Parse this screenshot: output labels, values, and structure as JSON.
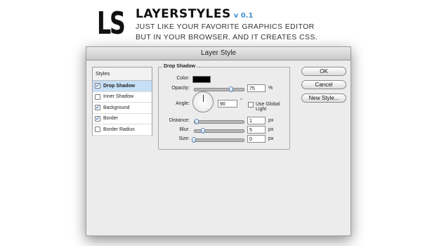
{
  "header": {
    "logo": "LS",
    "title": "LAYERSTYLES",
    "version": "v 0.1",
    "tagline_line1": "JUST LIKE YOUR FAVORITE GRAPHICS EDITOR",
    "tagline_line2": "BUT IN YOUR BROWSER. AND IT CREATES CSS."
  },
  "dialog": {
    "title": "Layer Style",
    "styles_header": "Styles",
    "styles": [
      {
        "label": "Drop Shadow",
        "checked": true,
        "selected": true
      },
      {
        "label": "Inner Shadow",
        "checked": false,
        "selected": false
      },
      {
        "label": "Background",
        "checked": true,
        "selected": false
      },
      {
        "label": "Border",
        "checked": true,
        "selected": false
      },
      {
        "label": "Border Radius",
        "checked": false,
        "selected": false
      }
    ],
    "panel": {
      "title": "Drop Shadow",
      "color_label": "Color:",
      "color_value": "#000000",
      "opacity_label": "Opacity:",
      "opacity_value": "75",
      "opacity_unit": "%",
      "opacity_slider": 0.75,
      "angle_label": "Angle:",
      "angle_value": "90",
      "angle_unit": "°",
      "global_light_label": "Use Global Light",
      "distance_label": "Distance:",
      "distance_value": "1",
      "distance_unit": "px",
      "distance_slider": 0.05,
      "blur_label": "Blur:",
      "blur_value": "5",
      "blur_unit": "px",
      "blur_slider": 0.18,
      "size_label": "Size:",
      "size_value": "0",
      "size_unit": "px",
      "size_slider": 0.0
    },
    "buttons": {
      "ok": "OK",
      "cancel": "Cancel",
      "new_style": "New Style..."
    }
  },
  "colors": {
    "accent": "#3d8fd0",
    "selected_row": "#c6dff7"
  }
}
